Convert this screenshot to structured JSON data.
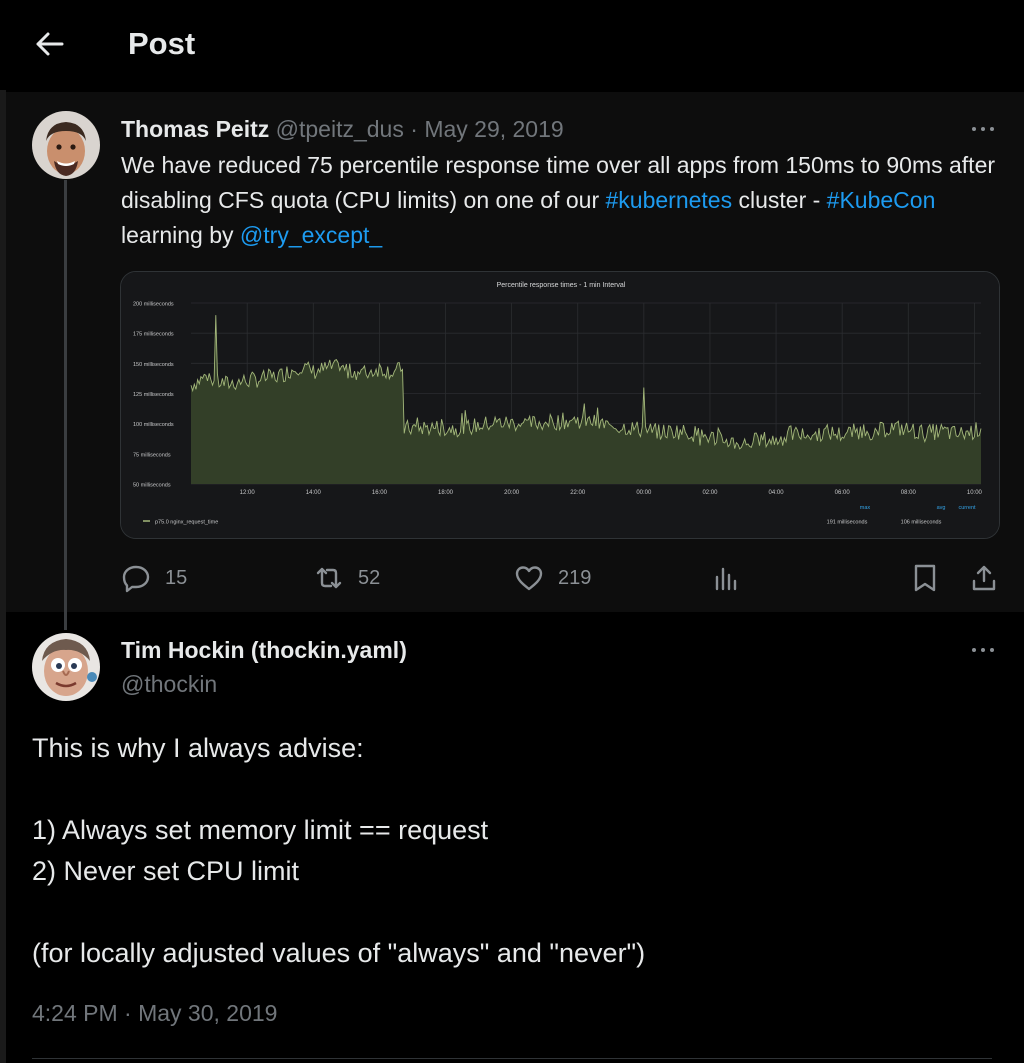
{
  "header": {
    "title": "Post"
  },
  "quoted_post": {
    "author_name": "Thomas Peitz",
    "author_handle": "@tpeitz_dus",
    "separator": "·",
    "date": "May 29, 2019",
    "text_1": "We have reduced 75 percentile response time over all apps from 150ms to 90ms after disabling CFS quota (CPU limits) on one of our ",
    "hashtag_1": "#kubernetes",
    "text_2": " cluster - ",
    "hashtag_2": "#KubeCon",
    "text_3": " learning by ",
    "mention": "@try_except_",
    "stats": {
      "replies": "15",
      "reposts": "52",
      "likes": "219"
    }
  },
  "chart_data": {
    "type": "area",
    "title": "Percentile response times - 1 min Interval",
    "y_ticks": [
      "200 milliseconds",
      "175 milliseconds",
      "150 milliseconds",
      "125 milliseconds",
      "100 milliseconds",
      "75 milliseconds",
      "50 milliseconds"
    ],
    "x_ticks": [
      "12:00",
      "14:00",
      "16:00",
      "18:00",
      "20:00",
      "22:00",
      "00:00",
      "02:00",
      "04:00",
      "06:00",
      "08:00",
      "10:00"
    ],
    "ylim": [
      50,
      200
    ],
    "xlim_hours": [
      10.3,
      34.2
    ],
    "series": [
      {
        "name": "p75.0 nginx_request_time",
        "x": [
          10.3,
          10.8,
          11,
          11.4,
          11.8,
          12.4,
          13,
          13.6,
          14,
          14.6,
          15,
          15.6,
          16,
          16.4,
          16.7,
          16.75,
          17.5,
          18.5,
          19.5,
          20.5,
          21.5,
          22,
          22.5,
          23,
          23.5,
          24,
          24.5,
          25,
          25.5,
          26,
          26.5,
          27,
          27.5,
          28,
          28.5,
          29,
          29.5,
          30,
          30.5,
          31,
          31.5,
          32,
          32.5,
          33,
          33.5,
          34,
          34.2
        ],
        "y": [
          132,
          140,
          135,
          133,
          135,
          137,
          140,
          148,
          143,
          147,
          144,
          142,
          146,
          143,
          145,
          96,
          97,
          96,
          101,
          100,
          102,
          103,
          101,
          98,
          97,
          95,
          93,
          94,
          92,
          89,
          86,
          83,
          87,
          86,
          92,
          90,
          93,
          91,
          94,
          93,
          97,
          95,
          92,
          94,
          91,
          94,
          96
        ],
        "spikes": [
          [
            11.05,
            190
          ],
          [
            24,
            130
          ]
        ]
      }
    ],
    "legend": {
      "max_label": "max",
      "avg_label": "avg",
      "current_label": "current",
      "max_value": "191 milliseconds",
      "avg_value": "106 milliseconds"
    },
    "grid": true,
    "colors": {
      "line": "#a3b77a",
      "fill": "#333f28",
      "background": "#161719",
      "grid": "#2b2d30",
      "legend_accent": "#33a2e5"
    }
  },
  "main_post": {
    "author_name": "Tim Hockin (thockin.yaml)",
    "author_handle": "@thockin",
    "text": "This is why I always advise:\n\n1) Always set memory limit == request\n2) Never set CPU limit\n\n(for locally adjusted values of \"always\" and \"never\")",
    "timestamp": "4:24 PM · May 30, 2019"
  },
  "icons": {
    "back": "arrow-left-icon",
    "more": "more-horizontal-icon",
    "reply": "reply-icon",
    "repost": "repost-icon",
    "like": "heart-icon",
    "views": "views-icon",
    "bookmark": "bookmark-icon",
    "share": "share-icon"
  },
  "colors": {
    "accent": "#1d9bf0",
    "muted": "#71767b",
    "background": "#000000"
  }
}
